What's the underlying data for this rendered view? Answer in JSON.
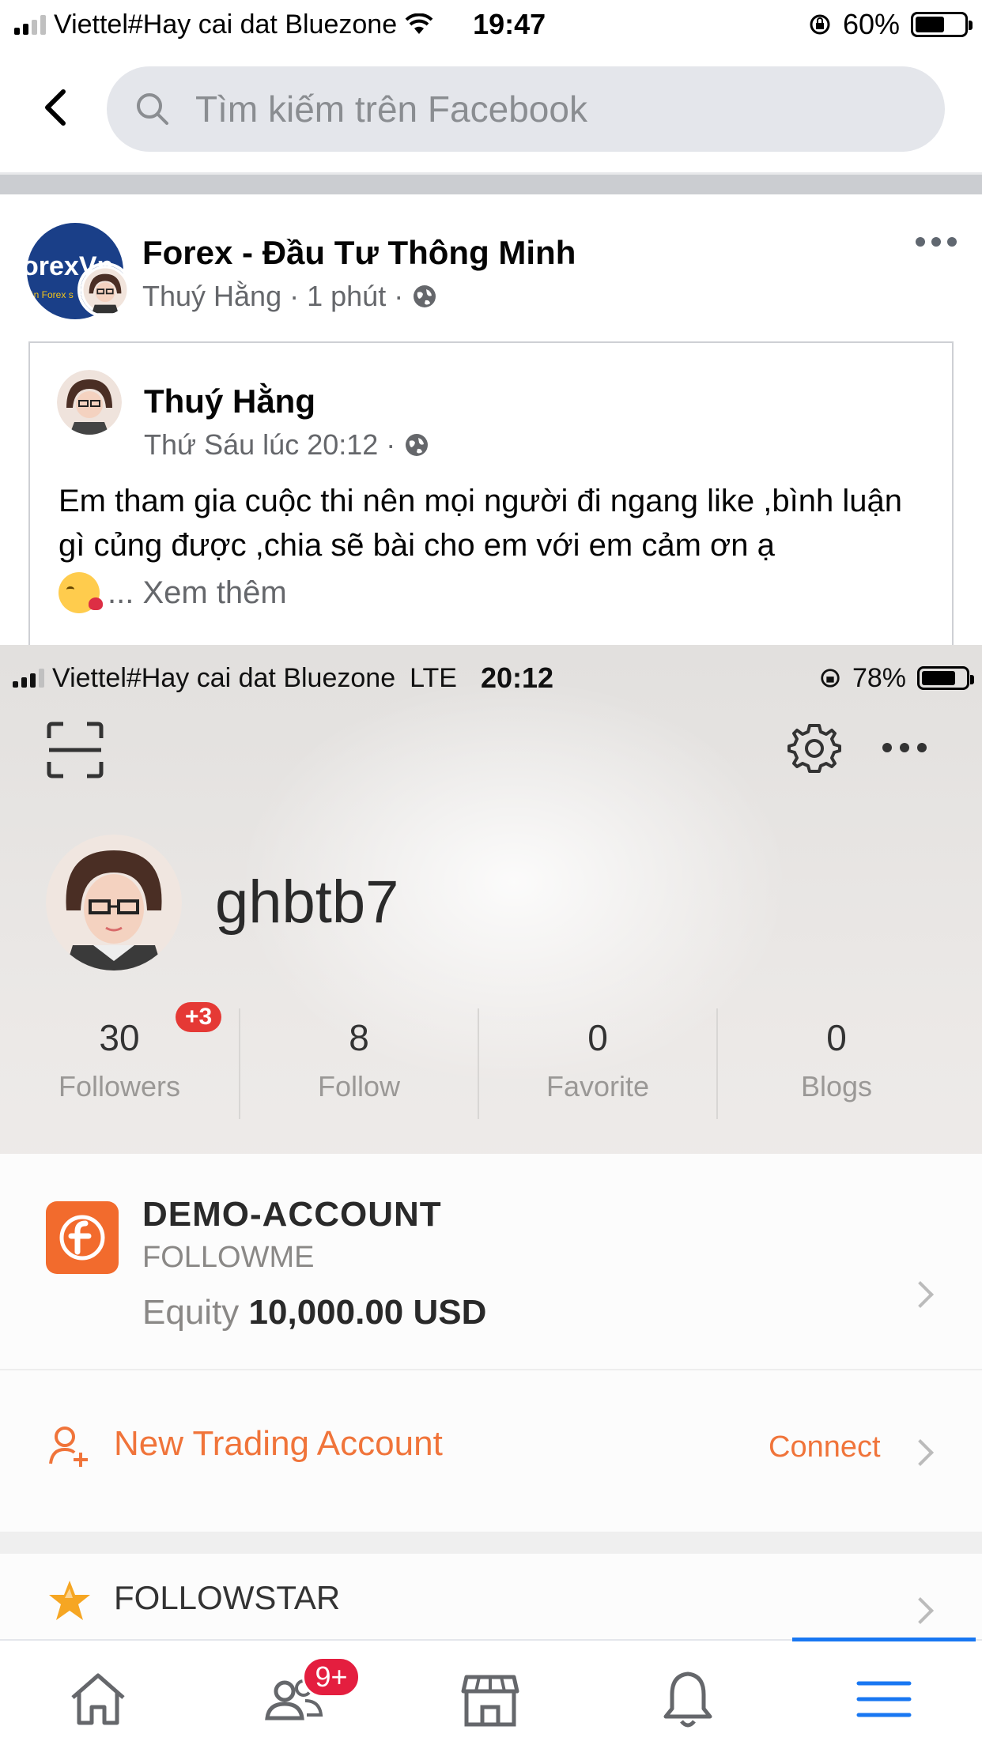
{
  "status_bar": {
    "carrier": "Viettel#Hay cai dat Bluezone",
    "time": "19:47",
    "battery": "60%",
    "battery_level": 0.6
  },
  "search": {
    "placeholder": "Tìm kiếm trên Facebook"
  },
  "post": {
    "group_name": "Forex - Đầu Tư Thông Minh",
    "group_logo_text": "orexVn",
    "group_logo_subtext": "ần Forex s",
    "author": "Thuý Hằng",
    "time": "1 phút",
    "shared": {
      "author": "Thuý Hằng",
      "time": "Thứ Sáu lúc 20:12",
      "text": "Em tham gia cuộc thi nên mọi người đi ngang like ,bình luận gì củng được ,chia sẽ bài cho em với em cảm ơn ạ",
      "see_more": "... Xem thêm"
    }
  },
  "screenshot": {
    "status": {
      "carrier": "Viettel#Hay cai dat Bluezone",
      "network": "LTE",
      "time": "20:12",
      "battery": "78%",
      "battery_level": 0.78
    },
    "profile": {
      "username": "ghbtb7"
    },
    "stats": [
      {
        "value": "30",
        "label": "Followers"
      },
      {
        "value": "8",
        "label": "Follow"
      },
      {
        "value": "0",
        "label": "Favorite"
      },
      {
        "value": "0",
        "label": "Blogs"
      }
    ],
    "followers_badge": "+3",
    "account": {
      "title": "DEMO-ACCOUNT",
      "broker": "FOLLOWME",
      "equity_label": "Equity",
      "equity_value": "10,000.00 USD"
    },
    "new_account": {
      "label": "New Trading Account",
      "action": "Connect"
    },
    "followstar": "FOLLOWSTAR",
    "accent_color": "#f0743a"
  },
  "bottom_nav": {
    "items": [
      "home-icon",
      "friends-icon",
      "marketplace-icon",
      "notifications-icon",
      "menu-icon"
    ],
    "friends_badge": "9+",
    "active": "menu"
  }
}
